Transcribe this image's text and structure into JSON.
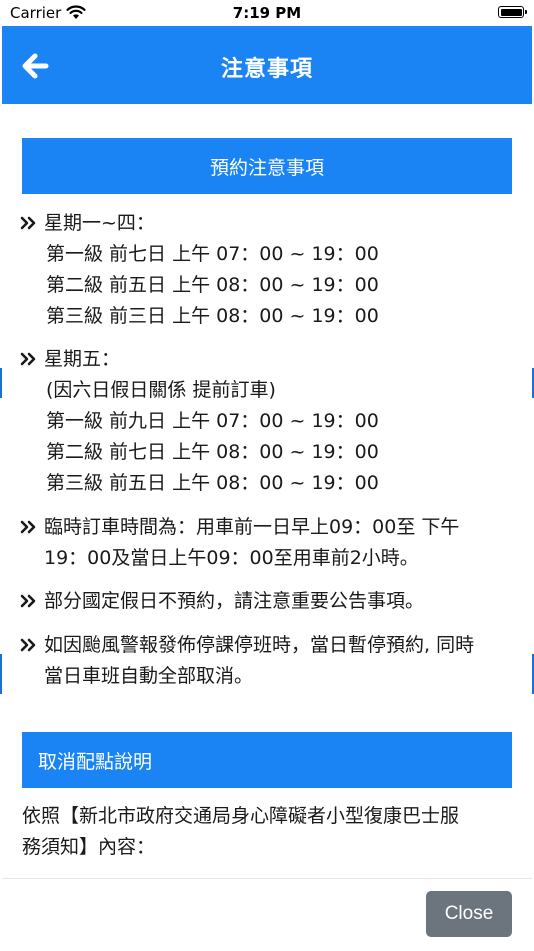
{
  "status_bar": {
    "carrier": "Carrier",
    "time": "7:19 PM"
  },
  "nav": {
    "title": "注意事項",
    "back_icon": "back-arrow-icon"
  },
  "reservation_notes": {
    "header": "預約注意事項",
    "bullets": [
      {
        "title": "星期一~四：",
        "lines": [
          "第一級 前七日 上午 07：00 ~ 19：00",
          "第二級 前五日 上午 08：00 ~ 19：00",
          "第三級 前三日 上午 08：00 ~ 19：00"
        ]
      },
      {
        "title": "星期五：",
        "lines": [
          "(因六日假日關係 提前訂車)",
          "第一級 前九日 上午 07：00 ~ 19：00",
          "第二級 前七日 上午 08：00 ~ 19：00",
          "第三級 前五日 上午 08：00 ~ 19：00"
        ]
      },
      {
        "title": "臨時訂車時間為：用車前一日早上09：00至 下午",
        "lines": [
          "19：00及當日上午09：00至用車前2小時。"
        ]
      },
      {
        "title": "部分國定假日不預約，請注意重要公告事項。",
        "lines": []
      },
      {
        "title": "如因颱風警報發佈停課停班時，當日暫停預約, 同時",
        "lines": [
          "當日車班自動全部取消。"
        ]
      }
    ]
  },
  "cancel_notes": {
    "header": "取消配點說明",
    "text_line1": "依照【新北市政府交通局身心障礙者小型復康巴士服",
    "text_line2": "務須知】內容："
  },
  "footer": {
    "close_label": "Close"
  },
  "colors": {
    "primary": "#1a84f5",
    "close_button": "#6c757d"
  }
}
